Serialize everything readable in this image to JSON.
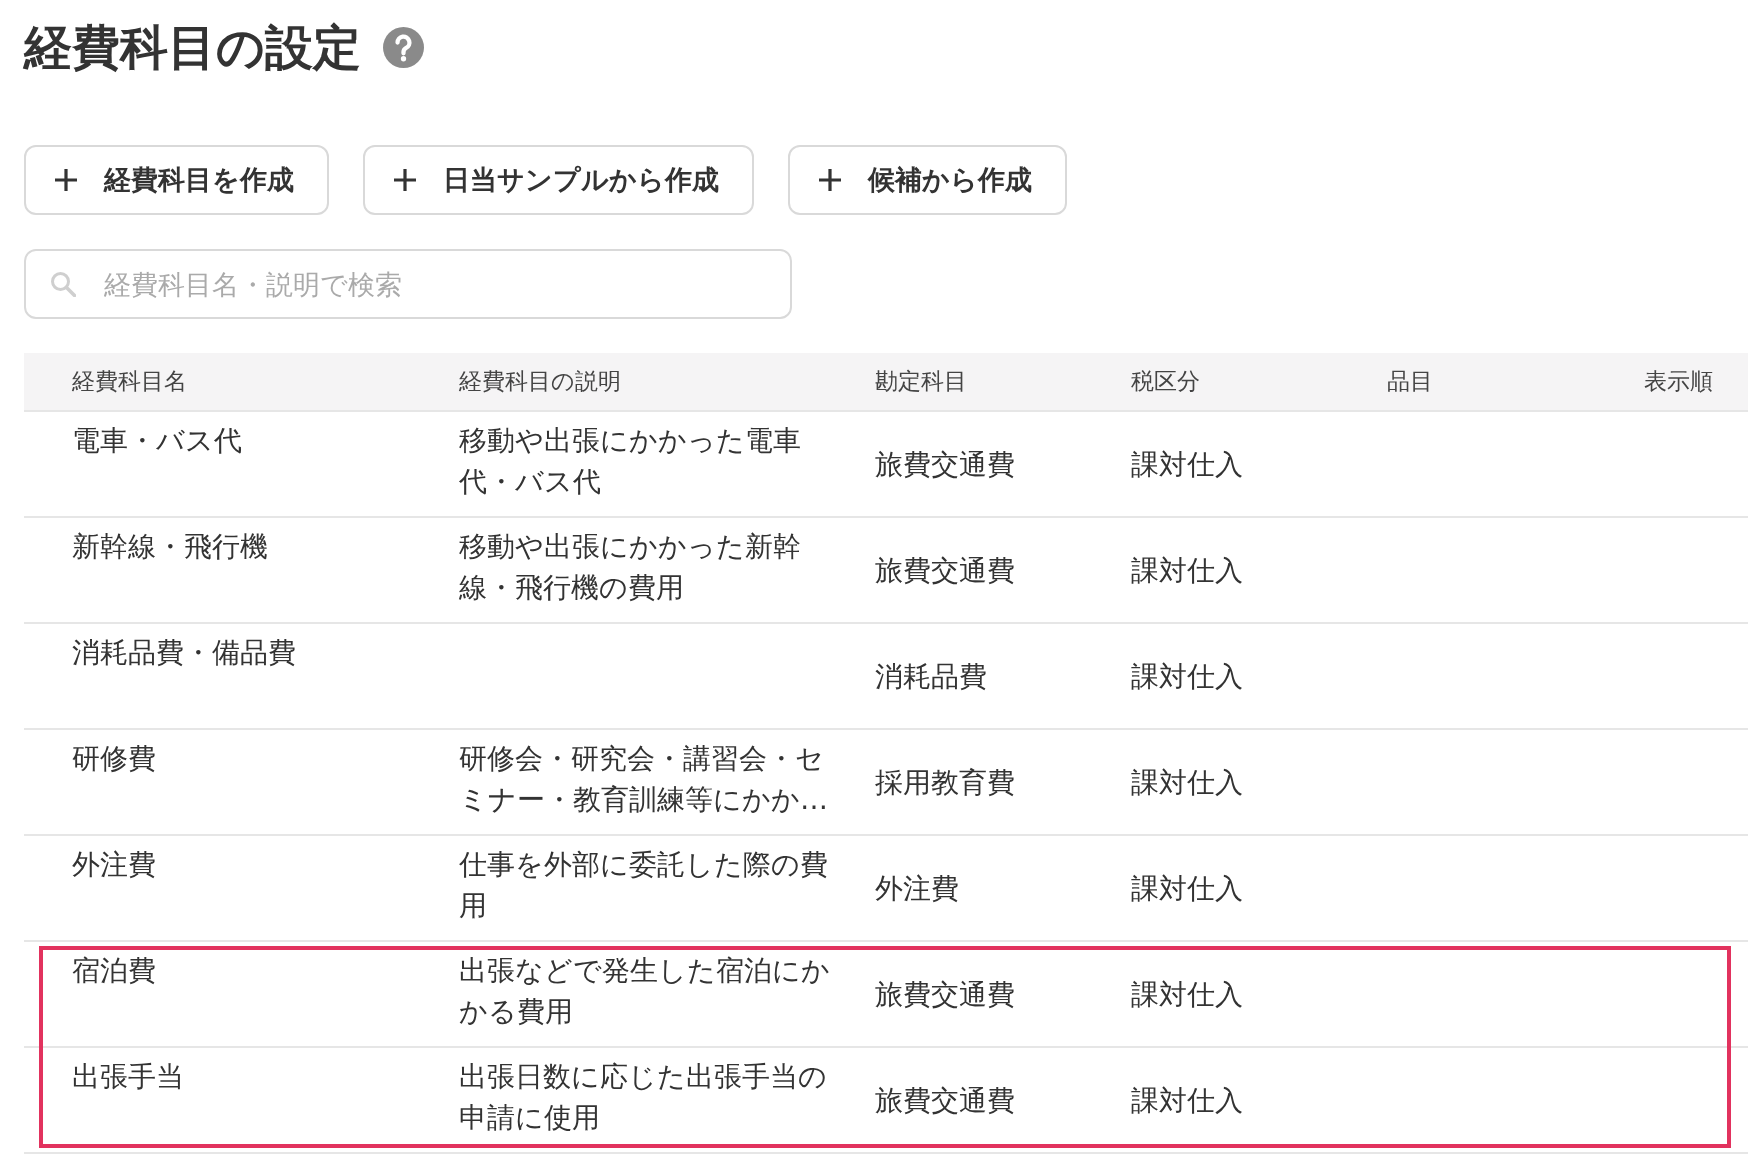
{
  "page": {
    "title": "経費科目の設定"
  },
  "actions": [
    {
      "label": "経費科目を作成"
    },
    {
      "label": "日当サンプルから作成"
    },
    {
      "label": "候補から作成"
    }
  ],
  "search": {
    "placeholder": "経費科目名・説明で検索"
  },
  "table": {
    "columns": [
      "経費科目名",
      "経費科目の説明",
      "勘定科目",
      "税区分",
      "品目",
      "表示順"
    ],
    "rows": [
      {
        "name": "電車・バス代",
        "description": "移動や出張にかかった電車代・バス代",
        "account": "旅費交通費",
        "tax": "課対仕入",
        "highlighted": false
      },
      {
        "name": "新幹線・飛行機",
        "description": "移動や出張にかかった新幹線・飛行機の費用",
        "account": "旅費交通費",
        "tax": "課対仕入",
        "highlighted": false
      },
      {
        "name": "消耗品費・備品費",
        "account": "消耗品費",
        "tax": "課対仕入",
        "highlighted": false
      },
      {
        "name": "研修費",
        "description": "研修会・研究会・講習会・セミナー・教育訓練等にかか…",
        "account": "採用教育費",
        "tax": "課対仕入",
        "highlighted": false
      },
      {
        "name": "外注費",
        "description": "仕事を外部に委託した際の費用",
        "account": "外注費",
        "tax": "課対仕入",
        "highlighted": false
      },
      {
        "name": "宿泊費",
        "description": "出張などで発生した宿泊にかかる費用",
        "account": "旅費交通費",
        "tax": "課対仕入",
        "highlighted": true
      },
      {
        "name": "出張手当",
        "description": "出張日数に応じた出張手当の申請に使用",
        "account": "旅費交通費",
        "tax": "課対仕入",
        "highlighted": true
      }
    ]
  }
}
